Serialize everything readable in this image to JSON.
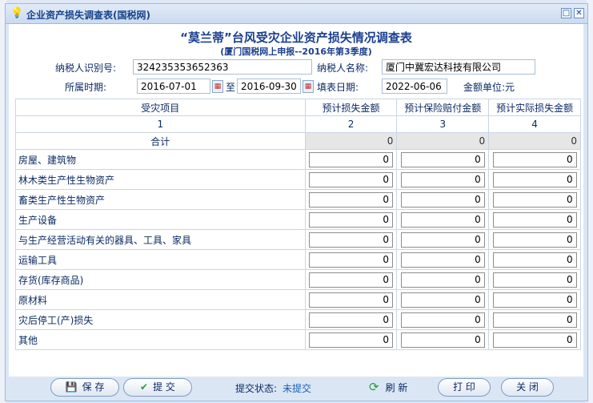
{
  "dialog": {
    "title": "企业资产损失调查表(国税网)",
    "minimize_glyph": "□",
    "close_glyph": "✕"
  },
  "form": {
    "heading": "“莫兰蒂”台风受灾企业资产损失情况调查表",
    "subheading": "(厦门国税网上申报--2016年第3季度)",
    "taxpayer_id_label": "纳税人识别号:",
    "taxpayer_id_value": "324235353652363",
    "taxpayer_name_label": "纳税人名称:",
    "taxpayer_name_value": "厦门中冀宏达科技有限公司",
    "period_label": "所属时期:",
    "period_start": "2016-07-01",
    "period_to": "至",
    "period_end": "2016-09-30",
    "fill_date_label": "填表日期:",
    "fill_date_value": "2022-06-06",
    "unit_label": "金额单位:元"
  },
  "table": {
    "headers": [
      "受灾项目",
      "预计损失金额",
      "预计保险赔付金额",
      "预计实际损失金额"
    ],
    "numbers": [
      "1",
      "2",
      "3",
      "4"
    ],
    "total": {
      "label": "合计",
      "values": [
        "0",
        "0",
        "0"
      ]
    },
    "rows": [
      {
        "label": "房屋、建筑物",
        "values": [
          "0",
          "0",
          "0"
        ]
      },
      {
        "label": "林木类生产性生物资产",
        "values": [
          "0",
          "0",
          "0"
        ]
      },
      {
        "label": "畜类生产性生物资产",
        "values": [
          "0",
          "0",
          "0"
        ]
      },
      {
        "label": "生产设备",
        "values": [
          "0",
          "0",
          "0"
        ]
      },
      {
        "label": "与生产经营活动有关的器具、工具、家具",
        "values": [
          "0",
          "0",
          "0"
        ]
      },
      {
        "label": "运输工具",
        "values": [
          "0",
          "0",
          "0"
        ]
      },
      {
        "label": "存货(库存商品)",
        "values": [
          "0",
          "0",
          "0"
        ]
      },
      {
        "label": "原材料",
        "values": [
          "0",
          "0",
          "0"
        ]
      },
      {
        "label": "灾后停工(产)损失",
        "values": [
          "0",
          "0",
          "0"
        ]
      },
      {
        "label": "其他",
        "values": [
          "0",
          "0",
          "0"
        ]
      }
    ]
  },
  "footer": {
    "save_label": "保 存",
    "submit_label": "提 交",
    "status_label": "提交状态:",
    "status_value": "未提交",
    "refresh_label": "刷 新",
    "print_label": "打 印",
    "close_label": "关 闭"
  },
  "icons": {
    "bulb": "lightbulb-icon",
    "save": "floppy-disk-icon",
    "submit": "checkmark-icon",
    "refresh": "refresh-icon",
    "calendar": "calendar-icon"
  }
}
